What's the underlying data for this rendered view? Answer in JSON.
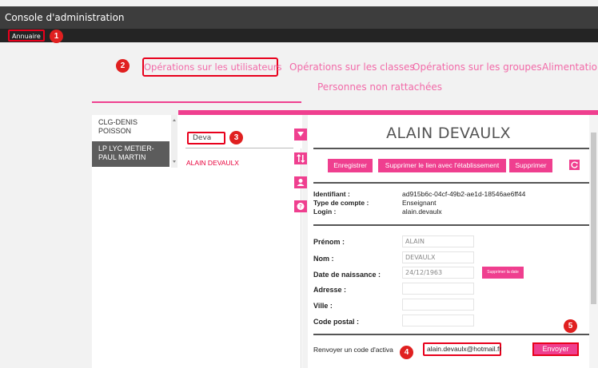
{
  "window": {
    "title": "Console d'administration"
  },
  "menu": {
    "annuaire": "Annuaire"
  },
  "markers": [
    "1",
    "2",
    "3",
    "4",
    "5"
  ],
  "nav": {
    "users": "Opérations sur les utilisateurs",
    "classes": "Opérations sur les classes",
    "groups": "Opérations sur les groupes",
    "feed": "Alimentation",
    "unattached": "Personnes non rattachées"
  },
  "schools": [
    {
      "line1": "CLG-DENIS",
      "line2": "POISSON"
    },
    {
      "line1": "LP LYC METIER-",
      "line2": "PAUL MARTIN"
    }
  ],
  "search": {
    "value": "Deva"
  },
  "results": [
    "ALAIN DEVAULX"
  ],
  "side_icons": [
    "filter-icon",
    "sort-icon",
    "user-icon",
    "help-icon"
  ],
  "user": {
    "name": "ALAIN DEVAULX",
    "buttons": {
      "save": "Enregistrer",
      "unlink": "Supprimer le lien avec l'établissement",
      "delete": "Supprimer"
    },
    "info": {
      "id_label": "Identifiant :",
      "id_value": "ad915b6c-04cf-49b2-ae1d-18546ae6ff44",
      "type_label": "Type de compte :",
      "type_value": "Enseignant",
      "login_label": "Login :",
      "login_value": "alain.devaulx"
    },
    "form": {
      "firstname_label": "Prénom :",
      "firstname_value": "ALAIN",
      "lastname_label": "Nom :",
      "lastname_value": "DEVAULX",
      "birth_label": "Date de naissance :",
      "birth_value": "24/12/1963",
      "delete_date": "Supprimer la date",
      "address_label": "Adresse :",
      "city_label": "Ville :",
      "zip_label": "Code postal :"
    },
    "resend": {
      "label": "Renvoyer un code d'activa",
      "email": "alain.devaulx@hotmail.fr",
      "send": "Envoyer"
    }
  },
  "colors": {
    "accent": "#ef3f8f",
    "callout": "#e02020",
    "dark": "#3d3d3d"
  }
}
